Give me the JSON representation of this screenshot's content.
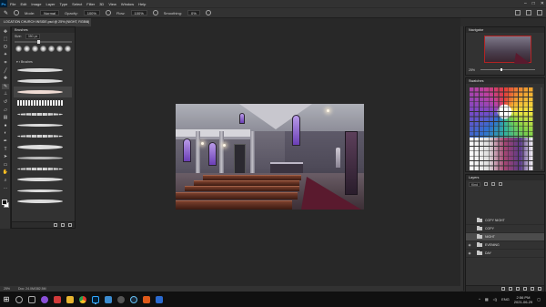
{
  "app": {
    "logo": "Ps",
    "menu": [
      "File",
      "Edit",
      "Image",
      "Layer",
      "Type",
      "Select",
      "Filter",
      "3D",
      "View",
      "Window",
      "Help"
    ],
    "window_controls": [
      "–",
      "□",
      "✕"
    ]
  },
  "options_bar": {
    "mode_label": "Mode:",
    "mode_value": "Normal",
    "opacity_label": "Opacity:",
    "opacity_value": "100%",
    "flow_label": "Flow:",
    "flow_value": "100%",
    "smoothing_label": "Smoothing:",
    "smoothing_value": "0%"
  },
  "document_tab": {
    "title": "LOCATION CHURCH INSIDE.psd @ 25% (NIGHT, RGB/8)",
    "close": "×"
  },
  "tools": [
    "move-icon",
    "marquee-icon",
    "lasso-icon",
    "quick-select-icon",
    "crop-icon",
    "eyedropper-icon",
    "healing-icon",
    "brush-icon",
    "clone-stamp-icon",
    "history-brush-icon",
    "eraser-icon",
    "gradient-icon",
    "blur-icon",
    "dodge-icon",
    "pen-icon",
    "type-icon",
    "path-select-icon",
    "rectangle-icon",
    "hand-icon",
    "zoom-icon",
    "more-icon"
  ],
  "brushes_panel": {
    "title": "Brushes",
    "size_label": "Size:",
    "size_value": "350 px",
    "folder_label": "Brushes"
  },
  "navigator_panel": {
    "title": "Navigator",
    "zoom": "25%"
  },
  "swatches_panel": {
    "title": "Swatches"
  },
  "layers_panel": {
    "title": "Layers",
    "filter_kind": "Kind",
    "layers": [
      {
        "name": "COPY NIGHT",
        "visible": false,
        "selected": false
      },
      {
        "name": "COPY",
        "visible": false,
        "selected": false
      },
      {
        "name": "NIGHT",
        "visible": false,
        "selected": true
      },
      {
        "name": "EVENING",
        "visible": true,
        "selected": false
      },
      {
        "name": "DAY",
        "visible": true,
        "selected": false
      }
    ]
  },
  "status_bar": {
    "zoom": "25%",
    "doc_info": "Doc: 24.0M/382.5M"
  },
  "taskbar": {
    "start": "⊞",
    "language": "ENG",
    "time": "2:56 PM",
    "date": "2021-06-29"
  },
  "colors": {
    "ps_blue": "#31a8ff",
    "selection_red": "#b32323",
    "carpet": "#5a1a2e",
    "window_glow": "#8a5fd8"
  }
}
